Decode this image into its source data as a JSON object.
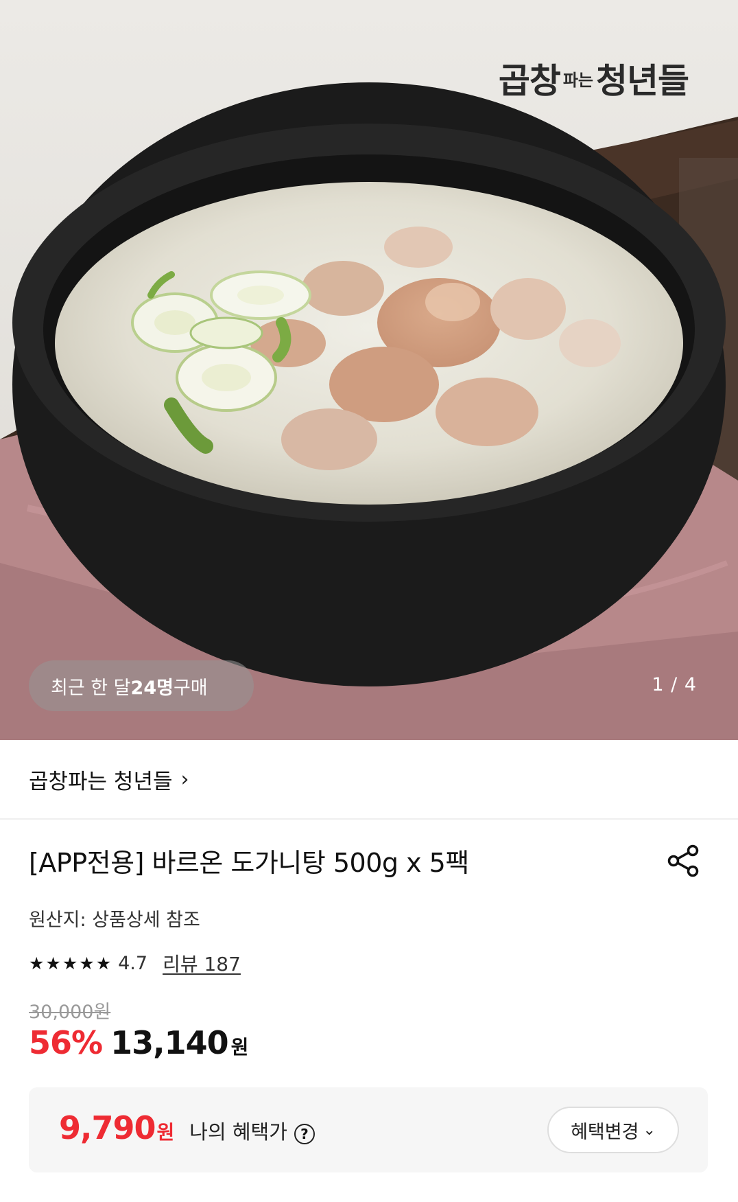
{
  "hero": {
    "brand_logo": {
      "part1": "곱창",
      "part2": "파는",
      "part3": "청년들"
    },
    "purchase_prefix": "최근 한 달 ",
    "purchase_count": "24명",
    "purchase_suffix": " 구매",
    "image_counter": "1 / 4"
  },
  "seller": {
    "name": "곱창파는 청년들",
    "chevron": "›"
  },
  "product": {
    "title": "[APP전용] 바르온 도가니탕 500g x 5팩",
    "origin": "원산지: 상품상세 참조",
    "rating": {
      "stars": 4.7,
      "value": "4.7",
      "review_label": "리뷰 187"
    },
    "original_price": "30,000원",
    "discount": "56%",
    "sale_price": "13,140",
    "currency": "원"
  },
  "benefit": {
    "price": "9,790",
    "currency": "원",
    "label": "나의 혜택가",
    "help_glyph": "?",
    "change_button": "혜택변경",
    "change_chevron": "⌄"
  },
  "icons": {
    "share": "share-icon",
    "star": "star-icon",
    "help": "question-circle-icon",
    "chevron": "chevron-down-icon"
  },
  "colors": {
    "accent_red": "#ee2b33",
    "text": "#111111",
    "muted": "#999999"
  }
}
